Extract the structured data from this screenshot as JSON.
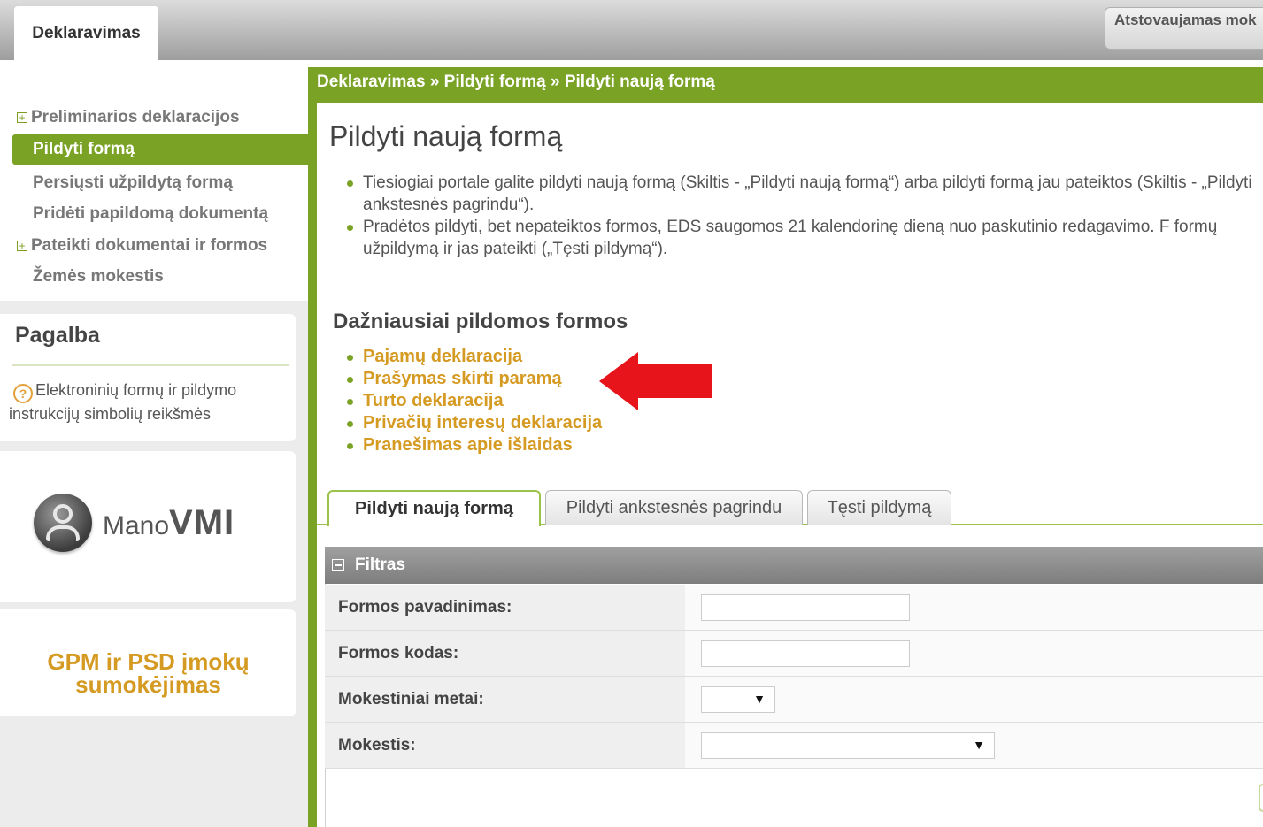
{
  "header": {
    "active_tab": "Deklaravimas",
    "representative_label": "Atstovaujamas mok"
  },
  "sidebar": {
    "items": [
      {
        "label": "Preliminarios deklaracijos",
        "expandable": true
      },
      {
        "label": "Pildyti formą",
        "active": true
      },
      {
        "label": "Persiųsti užpildytą formą"
      },
      {
        "label": "Pridėti papildomą dokumentą"
      },
      {
        "label": "Pateikti dokumentai ir formos",
        "expandable": true
      },
      {
        "label": "Žemės mokestis"
      }
    ],
    "help": {
      "title": "Pagalba",
      "link_line1": "Elektroninių formų ir pildymo",
      "link_line2": "instrukcijų simbolių reikšmės"
    },
    "mano_vmi": {
      "mano": "Mano",
      "vmi": "VMI"
    },
    "gpm": {
      "line1": "GPM ir PSD įmokų",
      "line2": "sumokėjimas"
    }
  },
  "breadcrumb": "Deklaravimas » Pildyti formą » Pildyti naują formą",
  "main": {
    "title": "Pildyti naują formą",
    "info": [
      "Tiesiogiai portale galite pildyti naują formą (Skiltis - „Pildyti naują formą“) arba pildyti formą jau pateiktos (Skiltis - „Pildyti ankstesnės pagrindu“).",
      "Pradėtos pildyti, bet nepateiktos formos, EDS saugomos 21 kalendorinę dieną nuo paskutinio redagavimo. F formų užpildymą ir jas pateikti („Tęsti pildymą“)."
    ],
    "frequent_title": "Dažniausiai pildomos formos",
    "frequent_forms": [
      "Pajamų deklaracija",
      "Prašymas skirti paramą",
      "Turto deklaracija",
      "Privačių interesų deklaracija",
      "Pranešimas apie išlaidas"
    ],
    "tabs": [
      "Pildyti naują formą",
      "Pildyti ankstesnės pagrindu",
      "Tęsti pildymą"
    ],
    "filter": {
      "title": "Filtras",
      "fields": [
        {
          "label": "Formos pavadinimas:",
          "value": ""
        },
        {
          "label": "Formos kodas:",
          "value": ""
        },
        {
          "label": "Mokestiniai metai:",
          "value": ""
        },
        {
          "label": "Mokestis:",
          "value": ""
        }
      ]
    }
  },
  "colors": {
    "accent_green": "#7aa325",
    "link_orange": "#d59a22",
    "arrow_red": "#e8141b"
  }
}
